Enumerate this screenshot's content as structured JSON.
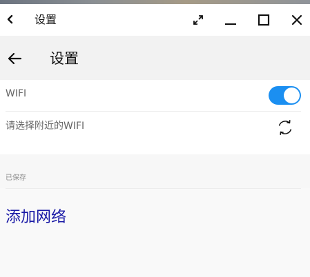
{
  "window": {
    "title": "设置",
    "buttons": [
      "fullscreen-icon",
      "minimize-icon",
      "maximize-icon",
      "close-icon"
    ]
  },
  "appbar": {
    "title": "设置"
  },
  "wifi": {
    "label": "WIFI",
    "enabled": true,
    "accent": "#1b8ff1",
    "select_label": "请选择附近的WIFI"
  },
  "saved": {
    "section_label": "已保存",
    "add_network": "添加网络",
    "add_network_color": "#1a1aa6"
  }
}
